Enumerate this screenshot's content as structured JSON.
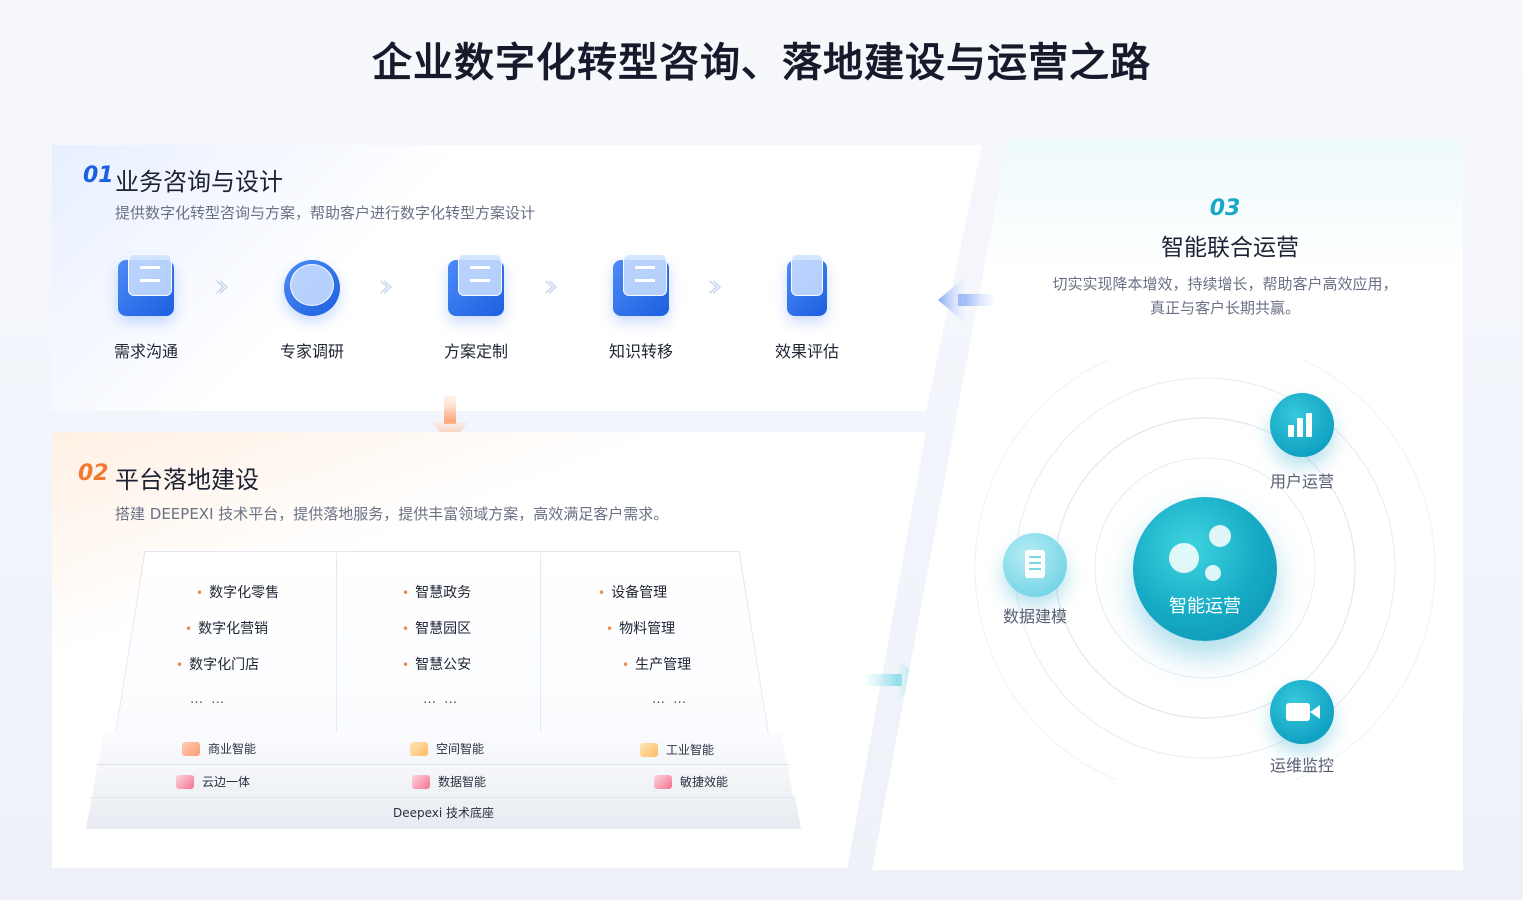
{
  "title": "企业数字化转型咨询、落地建设与运营之路",
  "section1": {
    "num": "01",
    "title": "业务咨询与设计",
    "desc": "提供数字化转型咨询与方案，帮助客户进行数字化转型方案设计",
    "steps": [
      {
        "label": "需求沟通",
        "icon": "chat-icon"
      },
      {
        "label": "专家调研",
        "icon": "search-icon"
      },
      {
        "label": "方案定制",
        "icon": "document-icon"
      },
      {
        "label": "知识转移",
        "icon": "book-icon"
      },
      {
        "label": "效果评估",
        "icon": "report-icon"
      }
    ],
    "accent": "#1c5fe0"
  },
  "section2": {
    "num": "02",
    "title": "平台落地建设",
    "desc": "搭建 DEEPEXI 技术平台，提供落地服务，提供丰富领域方案，高效满足客户需求。",
    "columns": [
      {
        "items": [
          "数字化零售",
          "数字化营销",
          "数字化门店"
        ],
        "more": "… …"
      },
      {
        "items": [
          "智慧政务",
          "智慧园区",
          "智慧公安"
        ],
        "more": "… …"
      },
      {
        "items": [
          "设备管理",
          "物料管理",
          "生产管理"
        ],
        "more": "… …"
      }
    ],
    "capabilities_row1": [
      "商业智能",
      "空间智能",
      "工业智能"
    ],
    "capabilities_row2": [
      "云边一体",
      "数据智能",
      "敏捷效能"
    ],
    "base": "Deepexi 技术底座",
    "accent": "#f07a32"
  },
  "section3": {
    "num": "03",
    "title": "智能联合运营",
    "desc_line1": "切实实现降本增效，持续增长，帮助客户高效应用，",
    "desc_line2": "真正与客户长期共赢。",
    "core": "智能运营",
    "satellites": {
      "user_ops": "用户运营",
      "data_model": "数据建模",
      "ops_monitor": "运维监控"
    },
    "accent": "#17a8c8"
  }
}
